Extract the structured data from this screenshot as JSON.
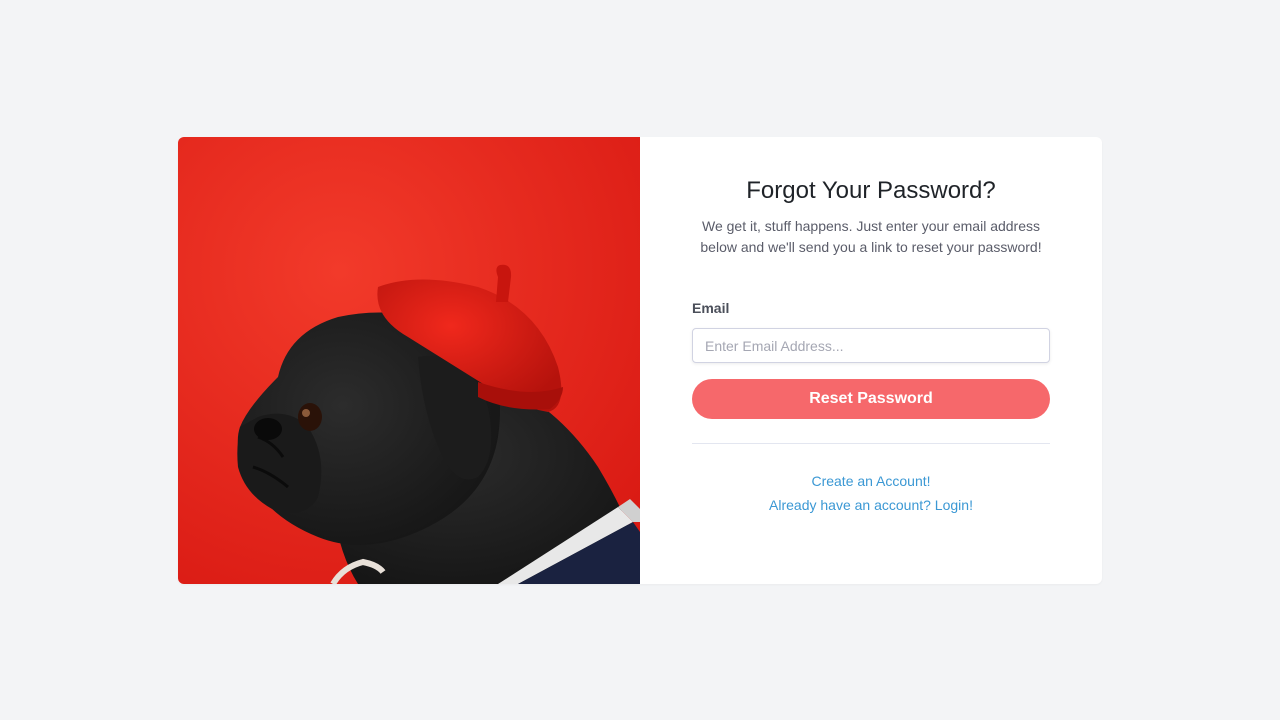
{
  "image": {
    "description_icon": "pug-in-red-beret-photo",
    "background_color": "#e8261c"
  },
  "form": {
    "title": "Forgot Your Password?",
    "subtitle": "We get it, stuff happens. Just enter your email address below and we'll send you a link to reset your password!",
    "email_label": "Email",
    "email_placeholder": "Enter Email Address...",
    "email_value": "",
    "submit_label": "Reset Password"
  },
  "links": {
    "create_account": "Create an Account!",
    "login": "Already have an account? Login!"
  },
  "colors": {
    "page_background": "#f3f4f6",
    "card_background": "#ffffff",
    "button": "#f6686b",
    "link": "#3b98d4"
  }
}
